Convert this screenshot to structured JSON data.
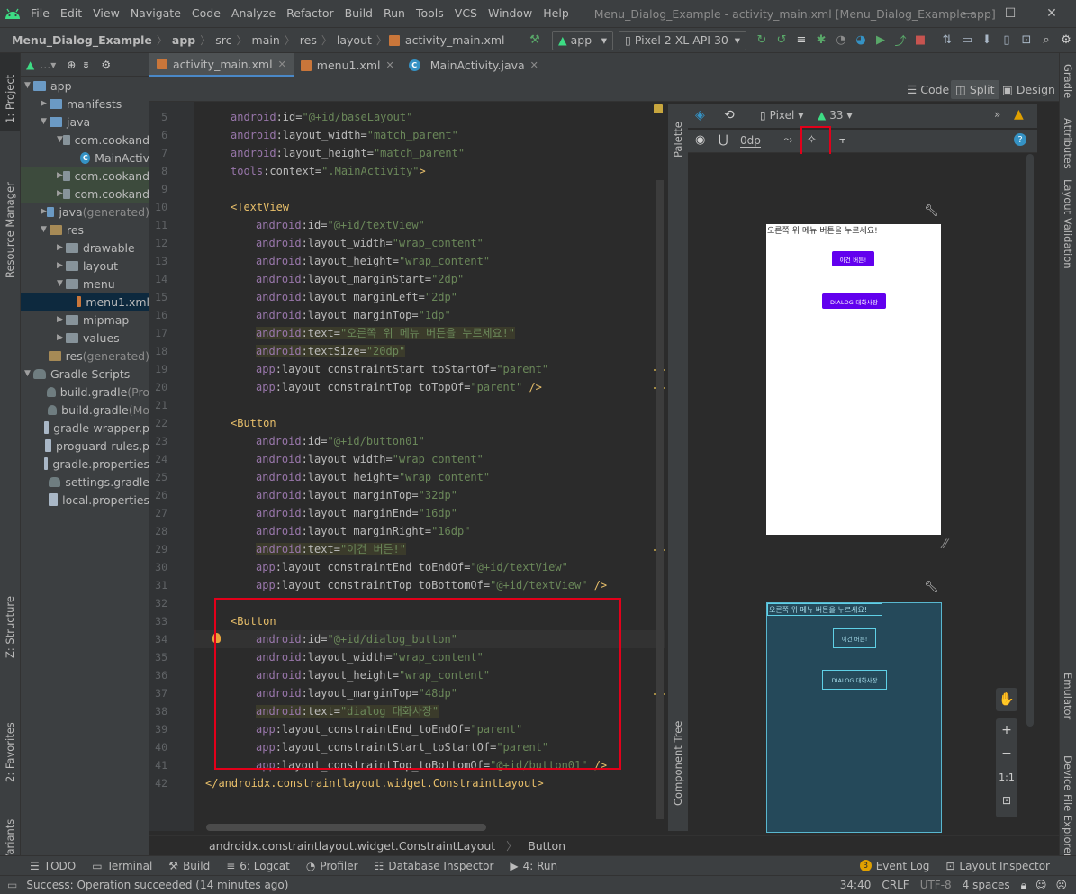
{
  "menubar": {
    "items": [
      "File",
      "Edit",
      "View",
      "Navigate",
      "Code",
      "Analyze",
      "Refactor",
      "Build",
      "Run",
      "Tools",
      "VCS",
      "Window",
      "Help"
    ],
    "window_title": "Menu_Dialog_Example - activity_main.xml [Menu_Dialog_Example.app]",
    "minimize": "—",
    "maximize": "☐",
    "close": "✕"
  },
  "navbar": {
    "breadcrumbs": [
      "Menu_Dialog_Example",
      "app",
      "src",
      "main",
      "res",
      "layout",
      "activity_main.xml"
    ],
    "run_config": "app",
    "device": "Pixel 2 XL API 30"
  },
  "leftstrip": {
    "project": "1: Project",
    "resource_manager": "Resource Manager",
    "structure": "Z: Structure",
    "favorites": "2: Favorites",
    "build_variants": "Build Variants"
  },
  "project_tree": [
    {
      "label": "app",
      "indent": 0,
      "arrow": "▼",
      "icon": "folder-blue"
    },
    {
      "label": "manifests",
      "indent": 1,
      "arrow": "▶",
      "icon": "folder-blue"
    },
    {
      "label": "java",
      "indent": 1,
      "arrow": "▼",
      "icon": "folder-blue"
    },
    {
      "label": "com.cookand",
      "indent": 2,
      "arrow": "▼",
      "icon": "folder"
    },
    {
      "label": "MainActiv",
      "indent": 3,
      "arrow": "",
      "icon": "class"
    },
    {
      "label": "com.cookand",
      "indent": 2,
      "arrow": "▶",
      "icon": "folder"
    },
    {
      "label": "com.cookand",
      "indent": 2,
      "arrow": "▶",
      "icon": "folder"
    },
    {
      "label": "java",
      "suffix": " (generated)",
      "indent": 1,
      "arrow": "▶",
      "icon": "folder-blue"
    },
    {
      "label": "res",
      "indent": 1,
      "arrow": "▼",
      "icon": "folder-orange"
    },
    {
      "label": "drawable",
      "indent": 2,
      "arrow": "▶",
      "icon": "folder"
    },
    {
      "label": "layout",
      "indent": 2,
      "arrow": "▶",
      "icon": "folder"
    },
    {
      "label": "menu",
      "indent": 2,
      "arrow": "▼",
      "icon": "folder"
    },
    {
      "label": "menu1.xml",
      "indent": 3,
      "arrow": "",
      "icon": "xml",
      "selected": true
    },
    {
      "label": "mipmap",
      "indent": 2,
      "arrow": "▶",
      "icon": "folder"
    },
    {
      "label": "values",
      "indent": 2,
      "arrow": "▶",
      "icon": "folder"
    },
    {
      "label": "res",
      "suffix": " (generated)",
      "indent": 1,
      "arrow": "",
      "icon": "folder-orange"
    },
    {
      "label": "Gradle Scripts",
      "indent": 0,
      "arrow": "▼",
      "icon": "gradle"
    },
    {
      "label": "build.gradle",
      "suffix": " (Pro",
      "indent": 1,
      "arrow": "",
      "icon": "gradle"
    },
    {
      "label": "build.gradle",
      "suffix": " (Mo",
      "indent": 1,
      "arrow": "",
      "icon": "gradle"
    },
    {
      "label": "gradle-wrapper.p",
      "indent": 1,
      "arrow": "",
      "icon": "file"
    },
    {
      "label": "proguard-rules.p",
      "indent": 1,
      "arrow": "",
      "icon": "file"
    },
    {
      "label": "gradle.properties",
      "indent": 1,
      "arrow": "",
      "icon": "file"
    },
    {
      "label": "settings.gradle",
      "indent": 1,
      "arrow": "",
      "icon": "gradle"
    },
    {
      "label": "local.properties",
      "indent": 1,
      "arrow": "",
      "icon": "file"
    }
  ],
  "tabs": [
    {
      "label": "activity_main.xml",
      "active": true,
      "icon": "xml"
    },
    {
      "label": "menu1.xml",
      "active": false,
      "icon": "xml"
    },
    {
      "label": "MainActivity.java",
      "active": false,
      "icon": "class"
    }
  ],
  "modes": {
    "code": "Code",
    "split": "Split",
    "design": "Design"
  },
  "code_lines": [
    {
      "n": 5,
      "segs": [
        [
          "a",
          "android"
        ],
        [
          "p",
          ":id="
        ],
        [
          "s",
          "\"@+id/baseLayout\""
        ]
      ],
      "ind": 2
    },
    {
      "n": 6,
      "segs": [
        [
          "a",
          "android"
        ],
        [
          "p",
          ":layout_width="
        ],
        [
          "s",
          "\"match_parent\""
        ]
      ],
      "ind": 2
    },
    {
      "n": 7,
      "segs": [
        [
          "a",
          "android"
        ],
        [
          "p",
          ":layout_height="
        ],
        [
          "s",
          "\"match_parent\""
        ]
      ],
      "ind": 2
    },
    {
      "n": 8,
      "segs": [
        [
          "a",
          "tools"
        ],
        [
          "p",
          ":context="
        ],
        [
          "s",
          "\".MainActivity\""
        ],
        [
          "t",
          ">"
        ]
      ],
      "ind": 2
    },
    {
      "n": 9,
      "segs": [],
      "ind": 0
    },
    {
      "n": 10,
      "segs": [
        [
          "t",
          "<TextView"
        ]
      ],
      "ind": 2
    },
    {
      "n": 11,
      "segs": [
        [
          "a",
          "android"
        ],
        [
          "p",
          ":id="
        ],
        [
          "s",
          "\"@+id/textView\""
        ]
      ],
      "ind": 4
    },
    {
      "n": 12,
      "segs": [
        [
          "a",
          "android"
        ],
        [
          "p",
          ":layout_width="
        ],
        [
          "s",
          "\"wrap_content\""
        ]
      ],
      "ind": 4
    },
    {
      "n": 13,
      "segs": [
        [
          "a",
          "android"
        ],
        [
          "p",
          ":layout_height="
        ],
        [
          "s",
          "\"wrap_content\""
        ]
      ],
      "ind": 4
    },
    {
      "n": 14,
      "segs": [
        [
          "a",
          "android"
        ],
        [
          "p",
          ":layout_marginStart="
        ],
        [
          "s",
          "\"2dp\""
        ]
      ],
      "ind": 4
    },
    {
      "n": 15,
      "segs": [
        [
          "a",
          "android"
        ],
        [
          "p",
          ":layout_marginLeft="
        ],
        [
          "s",
          "\"2dp\""
        ]
      ],
      "ind": 4
    },
    {
      "n": 16,
      "segs": [
        [
          "a",
          "android"
        ],
        [
          "p",
          ":layout_marginTop="
        ],
        [
          "s",
          "\"1dp\""
        ]
      ],
      "ind": 4
    },
    {
      "n": 17,
      "segs": [
        [
          "a",
          "android"
        ],
        [
          "p",
          ":text="
        ],
        [
          "s",
          "\"오른쪽 위 메뉴 버튼을 누르세요!\""
        ]
      ],
      "ind": 4,
      "hl": true
    },
    {
      "n": 18,
      "segs": [
        [
          "a",
          "android"
        ],
        [
          "p",
          ":textSize="
        ],
        [
          "s",
          "\"20dp\""
        ]
      ],
      "ind": 4,
      "hl": true
    },
    {
      "n": 19,
      "segs": [
        [
          "a",
          "app"
        ],
        [
          "p",
          ":layout_constraintStart_toStartOf="
        ],
        [
          "s",
          "\"parent\""
        ]
      ],
      "ind": 4
    },
    {
      "n": 20,
      "segs": [
        [
          "a",
          "app"
        ],
        [
          "p",
          ":layout_constraintTop_toTopOf="
        ],
        [
          "s",
          "\"parent\""
        ],
        [
          "t",
          " />"
        ]
      ],
      "ind": 4
    },
    {
      "n": 21,
      "segs": [],
      "ind": 0
    },
    {
      "n": 22,
      "segs": [
        [
          "t",
          "<Button"
        ]
      ],
      "ind": 2
    },
    {
      "n": 23,
      "segs": [
        [
          "a",
          "android"
        ],
        [
          "p",
          ":id="
        ],
        [
          "s",
          "\"@+id/button01\""
        ]
      ],
      "ind": 4
    },
    {
      "n": 24,
      "segs": [
        [
          "a",
          "android"
        ],
        [
          "p",
          ":layout_width="
        ],
        [
          "s",
          "\"wrap_content\""
        ]
      ],
      "ind": 4
    },
    {
      "n": 25,
      "segs": [
        [
          "a",
          "android"
        ],
        [
          "p",
          ":layout_height="
        ],
        [
          "s",
          "\"wrap_content\""
        ]
      ],
      "ind": 4
    },
    {
      "n": 26,
      "segs": [
        [
          "a",
          "android"
        ],
        [
          "p",
          ":layout_marginTop="
        ],
        [
          "s",
          "\"32dp\""
        ]
      ],
      "ind": 4
    },
    {
      "n": 27,
      "segs": [
        [
          "a",
          "android"
        ],
        [
          "p",
          ":layout_marginEnd="
        ],
        [
          "s",
          "\"16dp\""
        ]
      ],
      "ind": 4
    },
    {
      "n": 28,
      "segs": [
        [
          "a",
          "android"
        ],
        [
          "p",
          ":layout_marginRight="
        ],
        [
          "s",
          "\"16dp\""
        ]
      ],
      "ind": 4
    },
    {
      "n": 29,
      "segs": [
        [
          "a",
          "android"
        ],
        [
          "p",
          ":text="
        ],
        [
          "s",
          "\"이건 버튼!\""
        ]
      ],
      "ind": 4,
      "hl": true
    },
    {
      "n": 30,
      "segs": [
        [
          "a",
          "app"
        ],
        [
          "p",
          ":layout_constraintEnd_toEndOf="
        ],
        [
          "s",
          "\"@+id/textView\""
        ]
      ],
      "ind": 4
    },
    {
      "n": 31,
      "segs": [
        [
          "a",
          "app"
        ],
        [
          "p",
          ":layout_constraintTop_toBottomOf="
        ],
        [
          "s",
          "\"@+id/textView\""
        ],
        [
          "t",
          " />"
        ]
      ],
      "ind": 4
    },
    {
      "n": 32,
      "segs": [],
      "ind": 0
    },
    {
      "n": 33,
      "segs": [
        [
          "t",
          "<Button"
        ]
      ],
      "ind": 2
    },
    {
      "n": 34,
      "segs": [
        [
          "a",
          "android"
        ],
        [
          "p",
          ":id="
        ],
        [
          "s",
          "\"@+id/dialog_button\""
        ]
      ],
      "ind": 4,
      "current": true
    },
    {
      "n": 35,
      "segs": [
        [
          "a",
          "android"
        ],
        [
          "p",
          ":layout_width="
        ],
        [
          "s",
          "\"wrap_content\""
        ]
      ],
      "ind": 4
    },
    {
      "n": 36,
      "segs": [
        [
          "a",
          "android"
        ],
        [
          "p",
          ":layout_height="
        ],
        [
          "s",
          "\"wrap_content\""
        ]
      ],
      "ind": 4
    },
    {
      "n": 37,
      "segs": [
        [
          "a",
          "android"
        ],
        [
          "p",
          ":layout_marginTop="
        ],
        [
          "s",
          "\"48dp\""
        ]
      ],
      "ind": 4
    },
    {
      "n": 38,
      "segs": [
        [
          "a",
          "android"
        ],
        [
          "p",
          ":text="
        ],
        [
          "s",
          "\"dialog 대화사장\""
        ]
      ],
      "ind": 4,
      "hl": true
    },
    {
      "n": 39,
      "segs": [
        [
          "a",
          "app"
        ],
        [
          "p",
          ":layout_constraintEnd_toEndOf="
        ],
        [
          "s",
          "\"parent\""
        ]
      ],
      "ind": 4
    },
    {
      "n": 40,
      "segs": [
        [
          "a",
          "app"
        ],
        [
          "p",
          ":layout_constraintStart_toStartOf="
        ],
        [
          "s",
          "\"parent\""
        ]
      ],
      "ind": 4
    },
    {
      "n": 41,
      "segs": [
        [
          "a",
          "app"
        ],
        [
          "p",
          ":layout_constraintTop_toBottomOf="
        ],
        [
          "s",
          "\"@+id/button01\""
        ],
        [
          "t",
          " />"
        ]
      ],
      "ind": 4
    },
    {
      "n": 42,
      "segs": [
        [
          "t",
          "</androidx.constraintlayout.widget.ConstraintLayout>"
        ]
      ],
      "ind": 0
    }
  ],
  "design": {
    "device": "Pixel",
    "api": "33",
    "margin": "0dp",
    "palette": "Palette",
    "component_tree": "Component Tree",
    "preview_text": "오른쪽 위 메뉴 버튼을 누르세요!",
    "button1_text": "이건 버튼!",
    "button2_text": "DIALOG 대화사장",
    "zoom_ratio": "1:1"
  },
  "rightstrip": {
    "gradle": "Gradle",
    "attributes": "Attributes",
    "layout_validation": "Layout Validation",
    "emulator": "Emulator",
    "device_file_explorer": "Device File Explorer"
  },
  "xml_breadcrumb": [
    "androidx.constraintlayout.widget.ConstraintLayout",
    "Button"
  ],
  "bottom_tools": {
    "todo": "TODO",
    "terminal": "Terminal",
    "build": "Build",
    "logcat_num": "6",
    "logcat": ": Logcat",
    "profiler": "Profiler",
    "database_inspector": "Database Inspector",
    "run_num": "4",
    "run": ": Run",
    "event_log": "Event Log",
    "layout_inspector": "Layout Inspector",
    "event_count": "3"
  },
  "status": {
    "message": "Success: Operation succeeded (14 minutes ago)",
    "position": "34:40",
    "line_sep": "CRLF",
    "encoding": "UTF-8",
    "indent": "4 spaces"
  },
  "colors": {
    "android_green": "#3ddc84",
    "purple_button": "#6200ee",
    "highlight_red": "#e2001a",
    "accent_blue": "#4a88c7"
  }
}
